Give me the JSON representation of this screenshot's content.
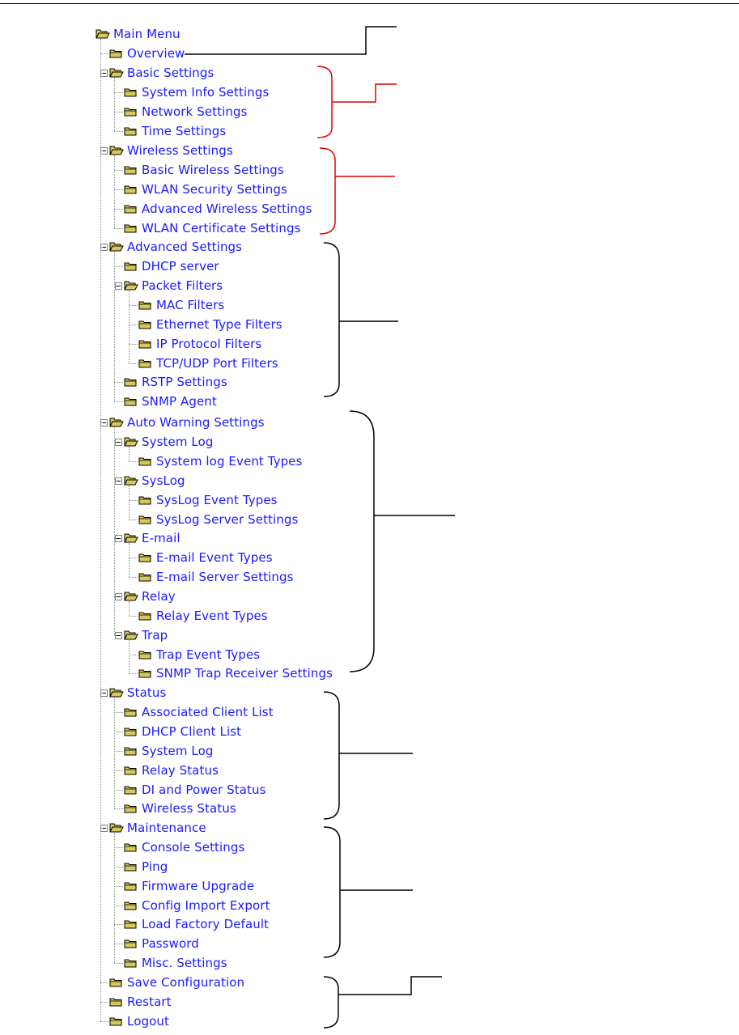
{
  "menu": {
    "items": [
      {
        "label": "Main Menu",
        "level": 0,
        "expanded": true,
        "icon": "open-folder-icon"
      },
      {
        "label": "Overview",
        "level": 1
      },
      {
        "label": "Basic Settings",
        "level": 1,
        "expanded": true
      },
      {
        "label": "System Info Settings",
        "level": 2
      },
      {
        "label": "Network Settings",
        "level": 2
      },
      {
        "label": "Time Settings",
        "level": 2
      },
      {
        "label": "Wireless Settings",
        "level": 1,
        "expanded": true
      },
      {
        "label": "Basic Wireless Settings",
        "level": 2
      },
      {
        "label": "WLAN Security Settings",
        "level": 2
      },
      {
        "label": "Advanced Wireless Settings",
        "level": 2
      },
      {
        "label": "WLAN Certificate Settings",
        "level": 2
      },
      {
        "label": "Advanced Settings",
        "level": 1,
        "expanded": true
      },
      {
        "label": "DHCP server",
        "level": 2
      },
      {
        "label": "Packet Filters",
        "level": 2,
        "expanded": true
      },
      {
        "label": "MAC Filters",
        "level": 3
      },
      {
        "label": "Ethernet Type Filters",
        "level": 3
      },
      {
        "label": "IP Protocol Filters",
        "level": 3
      },
      {
        "label": "TCP/UDP Port Filters",
        "level": 3
      },
      {
        "label": "RSTP Settings",
        "level": 2
      },
      {
        "label": "SNMP Agent",
        "level": 2
      },
      {
        "label": "Auto Warning Settings",
        "level": 1,
        "expanded": true
      },
      {
        "label": "System Log",
        "level": 2,
        "expanded": true
      },
      {
        "label": "System log Event Types",
        "level": 3
      },
      {
        "label": "SysLog",
        "level": 2,
        "expanded": true
      },
      {
        "label": "SysLog Event Types",
        "level": 3
      },
      {
        "label": "SysLog Server Settings",
        "level": 3
      },
      {
        "label": "E-mail",
        "level": 2,
        "expanded": true
      },
      {
        "label": "E-mail Event Types",
        "level": 3
      },
      {
        "label": "E-mail Server Settings",
        "level": 3
      },
      {
        "label": "Relay",
        "level": 2,
        "expanded": true
      },
      {
        "label": "Relay Event Types",
        "level": 3
      },
      {
        "label": "Trap",
        "level": 2,
        "expanded": true
      },
      {
        "label": "Trap Event Types",
        "level": 3
      },
      {
        "label": "SNMP Trap Receiver Settings",
        "level": 3
      },
      {
        "label": "Status",
        "level": 1,
        "expanded": true
      },
      {
        "label": "Associated Client List",
        "level": 2
      },
      {
        "label": "DHCP Client List",
        "level": 2
      },
      {
        "label": "System Log",
        "level": 2
      },
      {
        "label": "Relay Status",
        "level": 2
      },
      {
        "label": "DI and Power Status",
        "level": 2
      },
      {
        "label": "Wireless Status",
        "level": 2
      },
      {
        "label": "Maintenance",
        "level": 1,
        "expanded": true
      },
      {
        "label": "Console Settings",
        "level": 2
      },
      {
        "label": "Ping",
        "level": 2
      },
      {
        "label": "Firmware Upgrade",
        "level": 2
      },
      {
        "label": "Config Import Export",
        "level": 2
      },
      {
        "label": "Load Factory Default",
        "level": 2
      },
      {
        "label": "Password",
        "level": 2
      },
      {
        "label": "Misc. Settings",
        "level": 2
      },
      {
        "label": "Save Configuration",
        "level": 1
      },
      {
        "label": "Restart",
        "level": 1
      },
      {
        "label": "Logout",
        "level": 1
      }
    ]
  },
  "colors": {
    "link": "#1a1aff",
    "folder_fill": "#d8c85a",
    "folder_stroke": "#000000",
    "annotation_black": "#000000",
    "annotation_red": "#e00000"
  }
}
